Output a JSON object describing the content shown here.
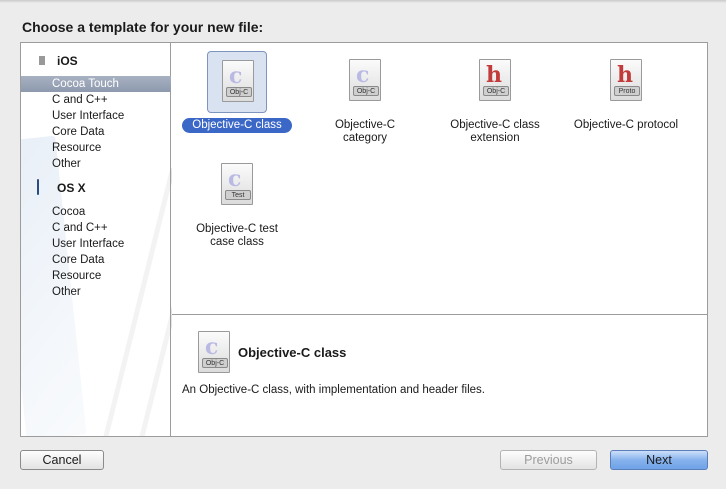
{
  "dialog": {
    "title": "Choose a template for your new file:"
  },
  "sidebar": {
    "groups": [
      {
        "name": "iOS",
        "icon": "iphone-icon",
        "items": [
          "Cocoa Touch",
          "C and C++",
          "User Interface",
          "Core Data",
          "Resource",
          "Other"
        ],
        "selected": "Cocoa Touch"
      },
      {
        "name": "OS X",
        "icon": "mac-icon",
        "items": [
          "Cocoa",
          "C and C++",
          "User Interface",
          "Core Data",
          "Resource",
          "Other"
        ]
      }
    ]
  },
  "templates": [
    {
      "label": "Objective-C class",
      "letter": "c",
      "tag": "Obj-C",
      "selected": true
    },
    {
      "label": "Objective-C category",
      "letter": "c",
      "tag": "Obj-C"
    },
    {
      "label": "Objective-C class extension",
      "letter": "h",
      "tag": "Obj-C"
    },
    {
      "label": "Objective-C protocol",
      "letter": "h",
      "tag": "Proto"
    },
    {
      "label": "Objective-C test case class",
      "letter": "c",
      "tag": "Test"
    }
  ],
  "description": {
    "title": "Objective-C class",
    "text": "An Objective-C class, with implementation and header files.",
    "letter": "c",
    "tag": "Obj-C"
  },
  "buttons": {
    "cancel": "Cancel",
    "previous": "Previous",
    "next": "Next"
  },
  "colors": {
    "selection": "#3b67c7",
    "sidebar_selected": "#8d99ad",
    "primary_button": "#6ea2e8"
  }
}
